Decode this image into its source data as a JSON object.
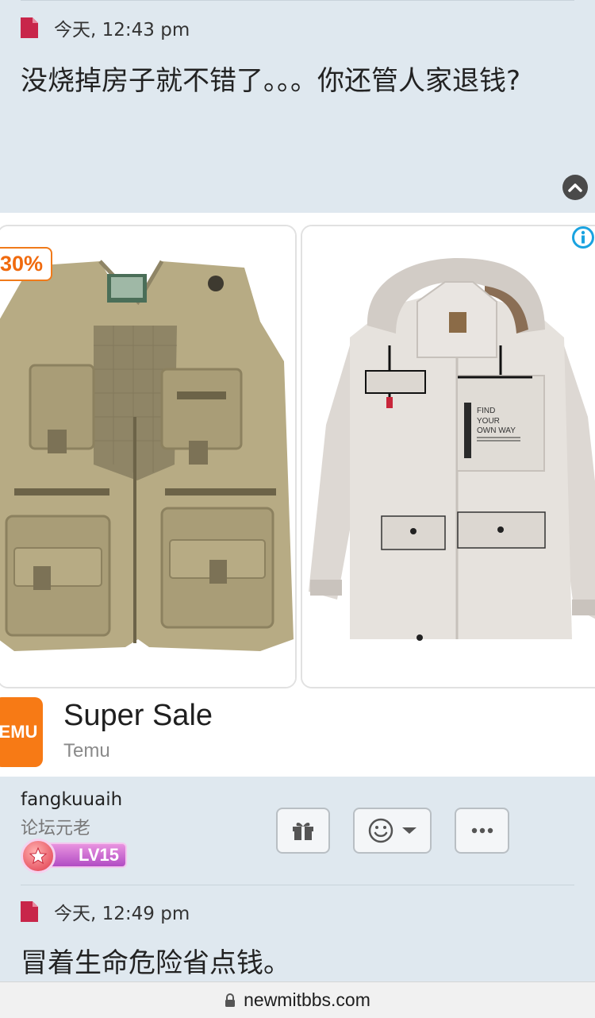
{
  "post1": {
    "timestamp": "今天, 12:43 pm",
    "text": "没烧掉房子就不错了。。。你还管人家退钱?"
  },
  "ad": {
    "discount_badge": "30%",
    "title": "Super Sale",
    "brand": "Temu",
    "logo_text": "EMU",
    "jacket_print": [
      "FIND",
      "YOUR",
      "OWN WAY"
    ],
    "colors": {
      "accent": "#f77a15",
      "info": "#1aa3e0"
    }
  },
  "user": {
    "name": "fangkuuaih",
    "rank": "论坛元老",
    "level": "LV15"
  },
  "actions": [
    {
      "icon": "gift-icon"
    },
    {
      "icon": "smiley-icon"
    },
    {
      "icon": "more-icon"
    }
  ],
  "post2": {
    "timestamp": "今天, 12:49 pm",
    "text": "冒着生命危险省点钱。"
  },
  "browser": {
    "url": "newmitbbs.com"
  }
}
